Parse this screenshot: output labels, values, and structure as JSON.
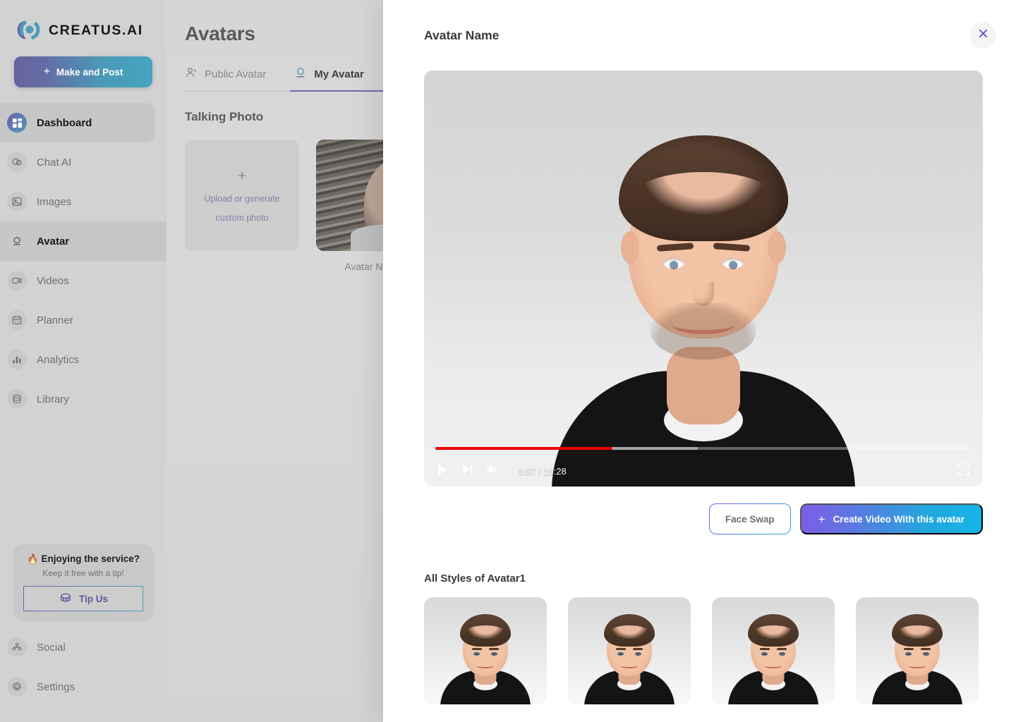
{
  "brand": {
    "name": "CREATUS.AI",
    "logo_icon": "creatus-logo-icon"
  },
  "sidebar": {
    "make_post_label": "Make and Post",
    "make_post_plus": "+",
    "items": [
      {
        "label": "Dashboard",
        "icon": "grid-dashboard-icon",
        "active": true
      },
      {
        "label": "Chat AI",
        "icon": "chat-bubbles-icon",
        "active": false
      },
      {
        "label": "Images",
        "icon": "image-picture-icon",
        "active": false
      },
      {
        "label": "Avatar",
        "icon": "avatar-person-icon",
        "active": true
      },
      {
        "label": "Videos",
        "icon": "video-camera-icon",
        "active": false
      },
      {
        "label": "Planner",
        "icon": "calendar-icon",
        "active": false
      },
      {
        "label": "Analytics",
        "icon": "bar-chart-icon",
        "active": false
      },
      {
        "label": "Library",
        "icon": "database-stack-icon",
        "active": false
      }
    ],
    "tip_card": {
      "title": "🔥 Enjoying the service?",
      "subtitle": "Keep it free with a tip!",
      "button_label": "Tip Us",
      "button_icon": "coin-icon"
    },
    "bottom_items": [
      {
        "label": "Social",
        "icon": "social-people-icon"
      },
      {
        "label": "Settings",
        "icon": "gear-icon"
      }
    ]
  },
  "background_page": {
    "title": "Avatars",
    "tabs": [
      {
        "label": "Public Avatar",
        "icon": "people-icon",
        "active": false
      },
      {
        "label": "My Avatar",
        "icon": "avatar-person-icon",
        "active": true
      }
    ],
    "section_title": "Talking Photo",
    "upload_card": {
      "plus": "+",
      "line1": "Upload or generate",
      "line2": "custom photo"
    },
    "photo_card_label": "Avatar Name"
  },
  "modal": {
    "title": "Avatar Name",
    "close_icon": "close-x-icon",
    "player": {
      "play_icon": "play-icon",
      "next_icon": "next-track-icon",
      "volume_icon": "volume-icon",
      "fullscreen_icon": "fullscreen-icon",
      "current_time": "5:07",
      "duration": "15:28",
      "time_display": "5:07 / 15:28",
      "played_percent": 33,
      "buffered_percent": 49
    },
    "actions": {
      "face_swap_label": "Face Swap",
      "create_video_label": "Create Video With this avatar",
      "create_video_plus": "+"
    },
    "styles": {
      "heading": "All Styles of Avatar1",
      "items": [
        {
          "name": "style-1"
        },
        {
          "name": "style-2"
        },
        {
          "name": "style-3"
        },
        {
          "name": "style-4"
        }
      ]
    }
  },
  "colors": {
    "accent_purple": "#6a5de0",
    "accent_cyan": "#14b4e6",
    "progress_red": "#f00000",
    "sidebar_bg": "#d2d2d2",
    "modal_bg": "#ffffff"
  }
}
